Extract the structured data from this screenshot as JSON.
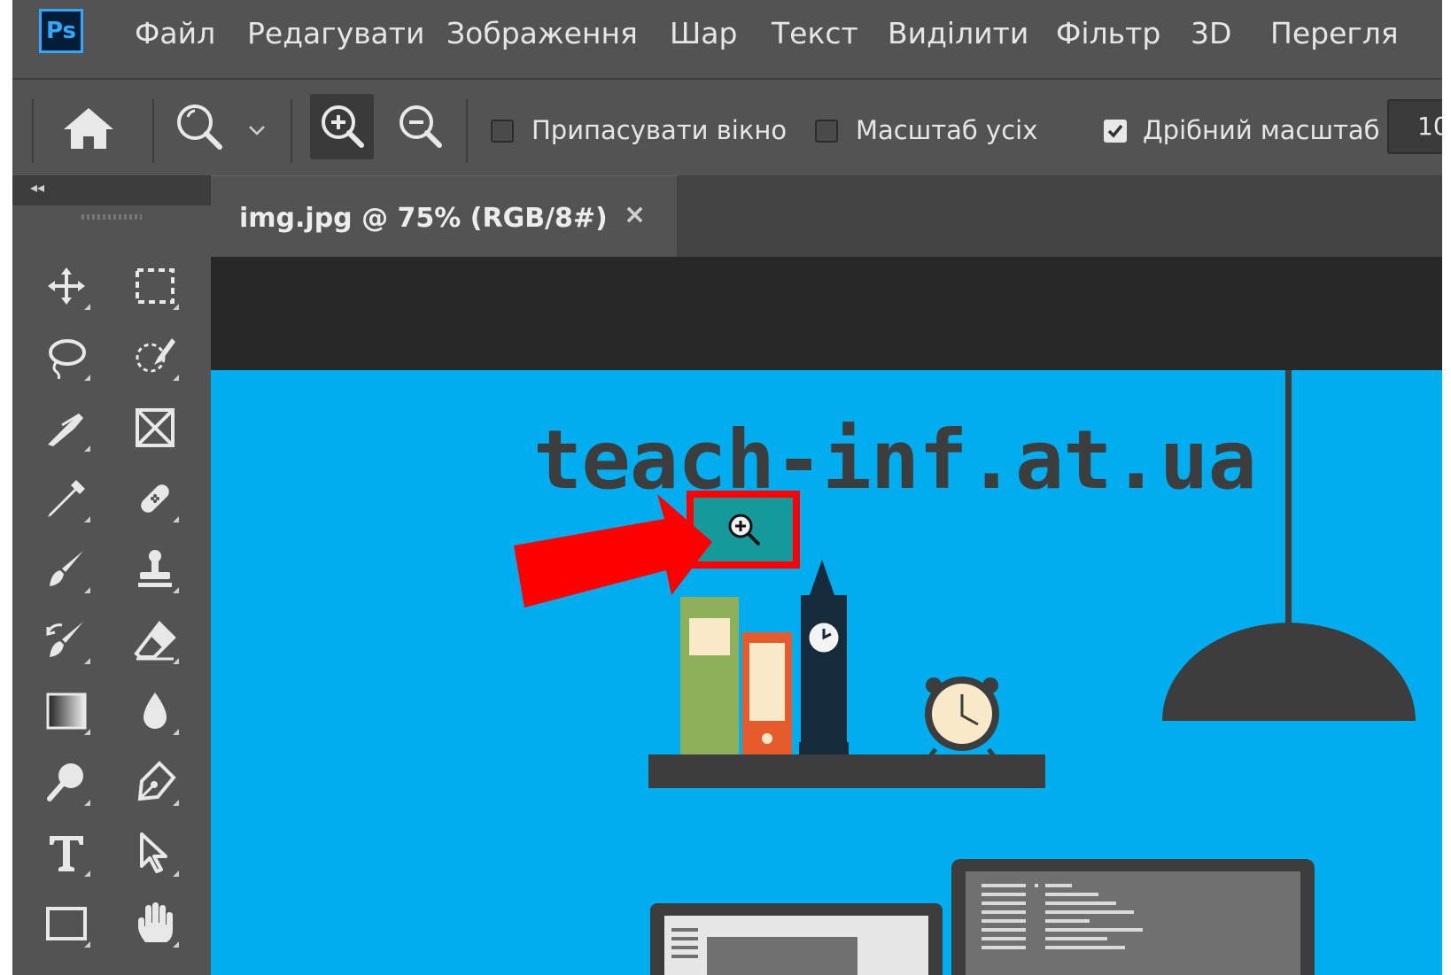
{
  "app": {
    "logo_text": "Ps"
  },
  "menu": {
    "items": [
      {
        "label": "Файл"
      },
      {
        "label": "Редагувати"
      },
      {
        "label": "Зображення"
      },
      {
        "label": "Шар"
      },
      {
        "label": "Текст"
      },
      {
        "label": "Виділити"
      },
      {
        "label": "Фільтр"
      },
      {
        "label": "3D"
      },
      {
        "label": "Перегля"
      }
    ]
  },
  "options": {
    "fit_window_label": "Припасувати вікно",
    "fit_window_checked": false,
    "zoom_all_label": "Масштаб усіх",
    "zoom_all_checked": false,
    "scrubby_zoom_label": "Дрібний масштаб",
    "scrubby_zoom_checked": true,
    "zoom_value": "10"
  },
  "tools": [
    {
      "icon": "move-icon"
    },
    {
      "icon": "marquee-icon"
    },
    {
      "icon": "lasso-icon"
    },
    {
      "icon": "quick-selection-icon"
    },
    {
      "icon": "crop-icon"
    },
    {
      "icon": "frame-icon"
    },
    {
      "icon": "eyedropper-icon"
    },
    {
      "icon": "healing-brush-icon"
    },
    {
      "icon": "brush-icon"
    },
    {
      "icon": "clone-stamp-icon"
    },
    {
      "icon": "history-brush-icon"
    },
    {
      "icon": "eraser-icon"
    },
    {
      "icon": "gradient-icon"
    },
    {
      "icon": "blur-icon"
    },
    {
      "icon": "dodge-icon"
    },
    {
      "icon": "pen-icon"
    },
    {
      "icon": "type-icon"
    },
    {
      "icon": "path-selection-icon"
    },
    {
      "icon": "rectangle-icon"
    },
    {
      "icon": "hand-icon"
    }
  ],
  "document": {
    "tab_title": "img.jpg @ 75% (RGB/8#)",
    "close_glyph": "×",
    "image_text": "teach-inf.at.ua"
  },
  "annotation": {
    "highlight_color": "#ff0000",
    "cursor_icon": "zoom-in-cursor-icon"
  },
  "colors": {
    "canvas": "#00aeef",
    "ui_bg": "#535353",
    "ps_blue": "#31a8ff"
  }
}
